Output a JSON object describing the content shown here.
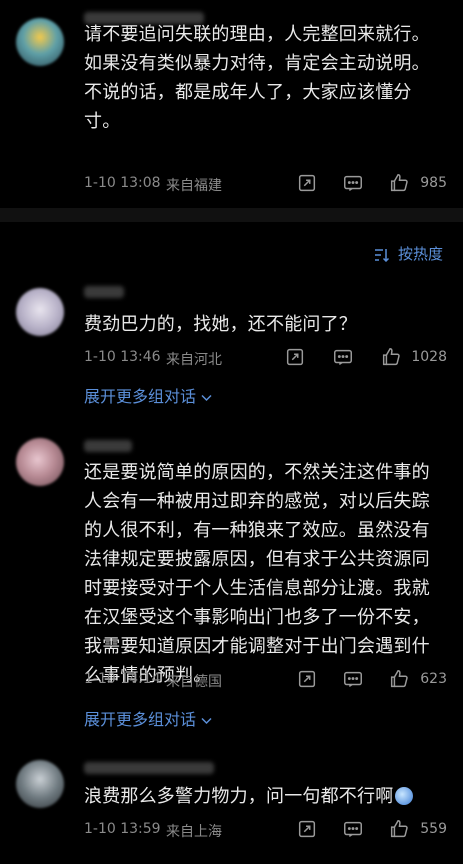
{
  "sort": {
    "label": "按热度"
  },
  "comments": [
    {
      "text": "请不要追问失联的理由，人完整回来就行。如果没有类似暴力对待，肯定会主动说明。不说的话，都是成年人了，大家应该懂分寸。",
      "time": "1-10 13:08",
      "location": "来自福建",
      "likes": "985"
    },
    {
      "text": "费劲巴力的，找她，还不能问了？",
      "time": "1-10 13:46",
      "location": "来自河北",
      "likes": "1028",
      "expand": "展开更多组对话"
    },
    {
      "text": "还是要说简单的原因的，不然关注这件事的人会有一种被用过即弃的感觉，对以后失踪的人很不利，有一种狼来了效应。虽然没有法律规定要披露原因，但有求于公共资源同时要接受对于个人生活信息部分让渡。我就在汉堡受这个事影响出门也多了一份不安，我需要知道原因才能调整对于出门会遇到什么事情的预判。",
      "time": "1-10 14:14",
      "location": "来自德国",
      "likes": "623",
      "expand": "展开更多组对话"
    },
    {
      "text": "浪费那么多警力物力，问一句都不行啊",
      "time": "1-10 13:59",
      "location": "来自上海",
      "likes": "559"
    }
  ],
  "icons": {
    "share": "share-icon",
    "comment": "comment-icon",
    "like": "thumbs-up-icon",
    "sort": "sort-icon",
    "chevron": "chevron-down-icon",
    "emoji": "emoji-icon"
  },
  "colors": {
    "background": "#000000",
    "text": "#e9e9e9",
    "meta": "#8a8a8a",
    "link": "#5b8fd9",
    "divider": "#111111"
  }
}
